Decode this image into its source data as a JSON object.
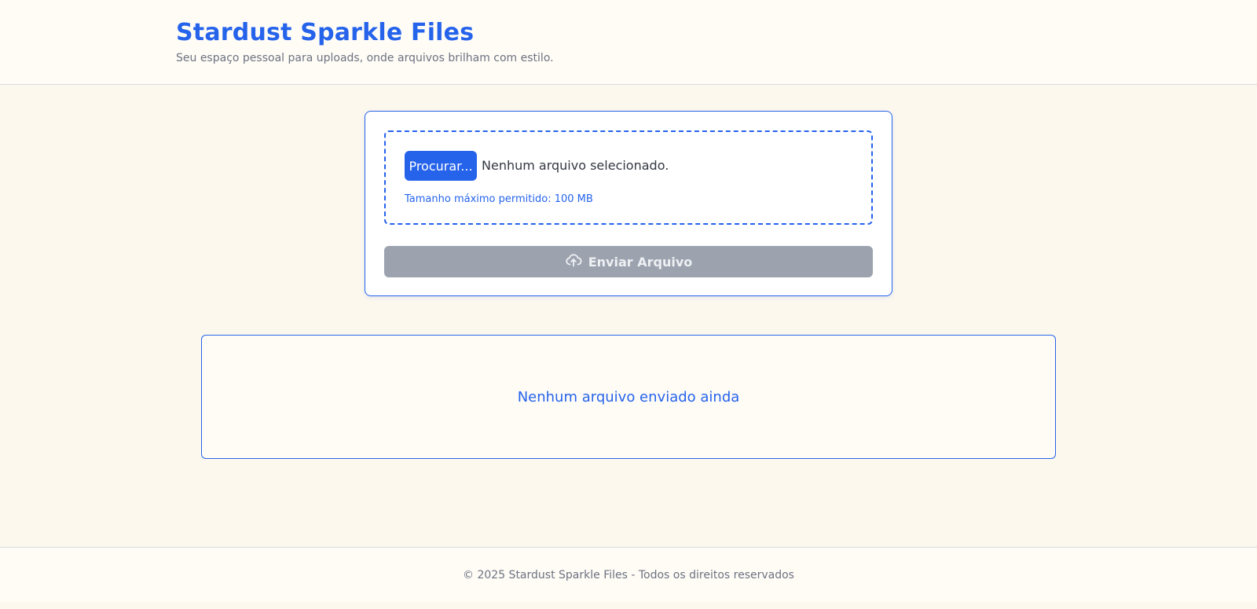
{
  "header": {
    "title": "Stardust Sparkle Files",
    "subtitle": "Seu espaço pessoal para uploads, onde arquivos brilham com estilo."
  },
  "upload": {
    "browse_label": "Procurar...",
    "file_status": "Nenhum arquivo selecionado.",
    "max_size_text": "Tamanho máximo permitido: 100 MB",
    "send_label": "Enviar Arquivo",
    "send_icon": "cloud-upload-icon"
  },
  "files": {
    "empty_message": "Nenhum arquivo enviado ainda"
  },
  "footer": {
    "text": "© 2025 Stardust Sparkle Files - Todos os direitos reservados"
  },
  "colors": {
    "accent": "#2563eb",
    "background": "#fdf8ee",
    "disabled_button": "#9ca3af"
  }
}
